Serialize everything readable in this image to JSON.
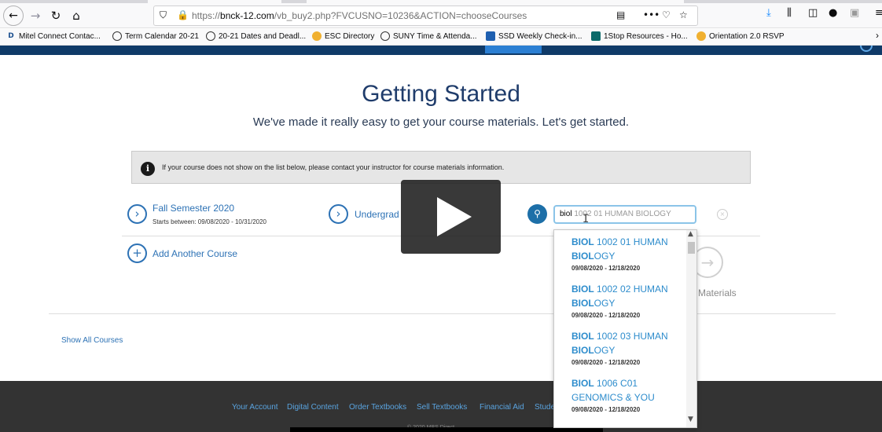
{
  "browser": {
    "url_prefix": "https://",
    "url_host": "bnck-12.com",
    "url_rest": "/vb_buy2.php?FVCUSNO=10236&ACTION=chooseCourses",
    "bookmarks": [
      "Mitel Connect Contac...",
      "Term Calendar 20-21",
      "20-21 Dates and Deadl...",
      "ESC Directory",
      "SUNY Time & Attenda...",
      "SSD Weekly Check-in...",
      "1Stop Resources - Ho...",
      "Orientation 2.0 RSVP"
    ]
  },
  "page": {
    "title": "Getting Started",
    "subtitle": "We've made it really easy to get your course materials. Let's get started.",
    "notice": "If your course does not show on the list below, please contact your instructor for course materials information.",
    "term": {
      "label": "Fall Semester 2020",
      "dates": "Starts between: 09/08/2020 - 10/31/2020"
    },
    "level_label": "Undergrad",
    "search": {
      "typed": "biol",
      "suggestion": " 1002 01 HUMAN BIOLOGY"
    },
    "add_course": "Add Another Course",
    "next_label": "ur Materials",
    "show_all": "Show All Courses"
  },
  "dropdown": {
    "items": [
      {
        "code_bold": "BIOL",
        "code_rest": " 1002 01 HUMAN ",
        "line2_bold": "BIOL",
        "line2_rest": "OGY",
        "dates": "09/08/2020 - 12/18/2020"
      },
      {
        "code_bold": "BIOL",
        "code_rest": " 1002 02 HUMAN ",
        "line2_bold": "BIOL",
        "line2_rest": "OGY",
        "dates": "09/08/2020 - 12/18/2020"
      },
      {
        "code_bold": "BIOL",
        "code_rest": " 1002 03 HUMAN ",
        "line2_bold": "BIOL",
        "line2_rest": "OGY",
        "dates": "09/08/2020 - 12/18/2020"
      },
      {
        "code_bold": "BIOL",
        "code_rest": " 1006 C01 ",
        "line2_bold": "",
        "line2_rest": "GENOMICS & YOU",
        "dates": "09/08/2020 - 12/18/2020"
      }
    ]
  },
  "footer": {
    "links": [
      "Your Account",
      "Digital Content",
      "Order Textbooks",
      "Sell Textbooks",
      "Financial Aid",
      "Stude"
    ],
    "copyright": "© 2020 MBS Direct"
  },
  "colors": {
    "accent": "#2d72b5",
    "title": "#1f3c6b",
    "footer_bg": "#333333",
    "footer_link": "#5aa4e0"
  },
  "icons": [
    "back-icon",
    "forward-icon",
    "reload-icon",
    "home-icon",
    "shield-icon",
    "lock-icon",
    "reader-icon",
    "more-icon",
    "pocket-icon",
    "star-icon",
    "download-icon",
    "library-icon",
    "sidebar-icon",
    "account-icon",
    "extension-icon",
    "menu-icon",
    "info-icon",
    "chevron-right-icon",
    "search-icon",
    "clear-icon",
    "plus-icon",
    "arrow-right-icon",
    "play-icon"
  ]
}
